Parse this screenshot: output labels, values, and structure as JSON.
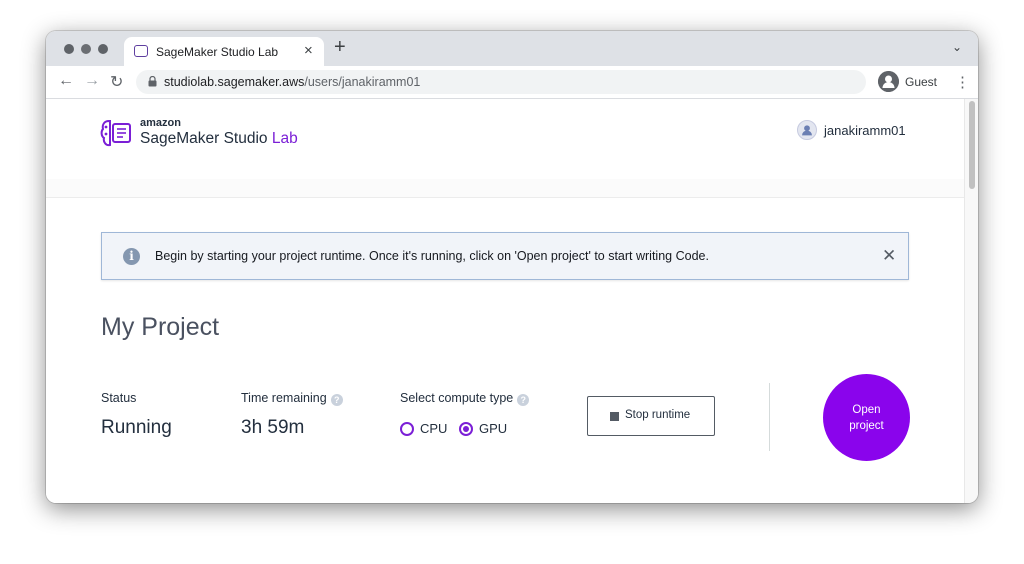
{
  "browser": {
    "tab_title": "SageMaker Studio Lab",
    "url_host": "studiolab.sagemaker.aws",
    "url_path": "/users/janakiramm01",
    "profile_label": "Guest"
  },
  "header": {
    "logo_amazon": "amazon",
    "logo_name_main": "SageMaker Studio ",
    "logo_name_accent": "Lab",
    "username": "janakiramm01"
  },
  "alert": {
    "message": "Begin by starting your project runtime. Once it's running, click on 'Open project' to start writing Code."
  },
  "project": {
    "title": "My Project",
    "status_label": "Status",
    "status_value": "Running",
    "time_label": "Time remaining",
    "time_value": "3h 59m",
    "compute_label": "Select compute type",
    "compute_options": [
      {
        "label": "CPU",
        "selected": false
      },
      {
        "label": "GPU",
        "selected": true
      }
    ],
    "stop_button": "Stop runtime",
    "open_button_line1": "Open",
    "open_button_line2": "project"
  },
  "colors": {
    "accent": "#7b1fd6",
    "open_button": "#8a04ec"
  }
}
